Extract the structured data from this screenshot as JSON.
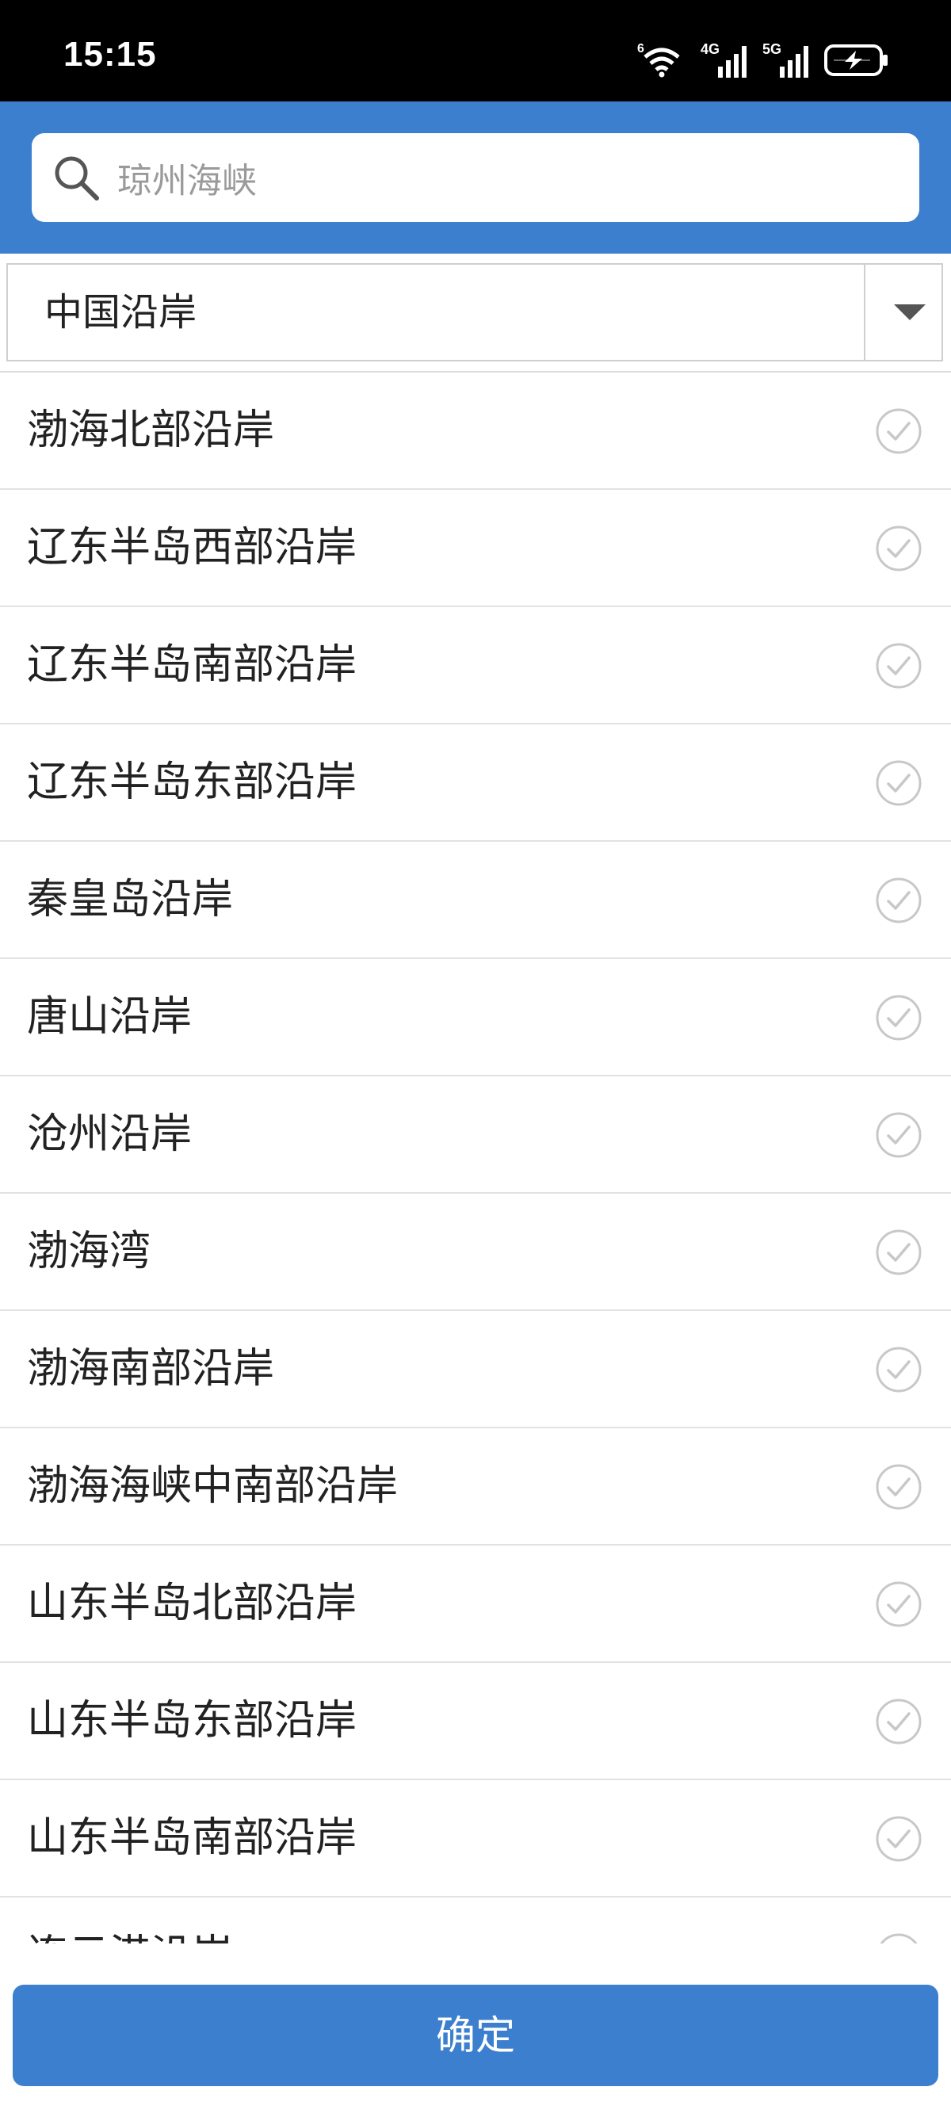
{
  "status_bar": {
    "time": "15:15",
    "wifi_badge": "6",
    "signal1_label": "4G",
    "signal2_label": "5G"
  },
  "search": {
    "placeholder": "琼州海峡"
  },
  "region_select": {
    "value": "中国沿岸"
  },
  "list": {
    "items": [
      {
        "label": "渤海北部沿岸"
      },
      {
        "label": "辽东半岛西部沿岸"
      },
      {
        "label": "辽东半岛南部沿岸"
      },
      {
        "label": "辽东半岛东部沿岸"
      },
      {
        "label": "秦皇岛沿岸"
      },
      {
        "label": "唐山沿岸"
      },
      {
        "label": "沧州沿岸"
      },
      {
        "label": "渤海湾"
      },
      {
        "label": "渤海南部沿岸"
      },
      {
        "label": "渤海海峡中南部沿岸"
      },
      {
        "label": "山东半岛北部沿岸"
      },
      {
        "label": "山东半岛东部沿岸"
      },
      {
        "label": "山东半岛南部沿岸"
      },
      {
        "label": "连云港沿岸"
      }
    ]
  },
  "confirm_button": {
    "label": "确定"
  },
  "colors": {
    "accent": "#3c7fce",
    "status_bar": "#000000",
    "check_icon": "#c8c8c8"
  }
}
